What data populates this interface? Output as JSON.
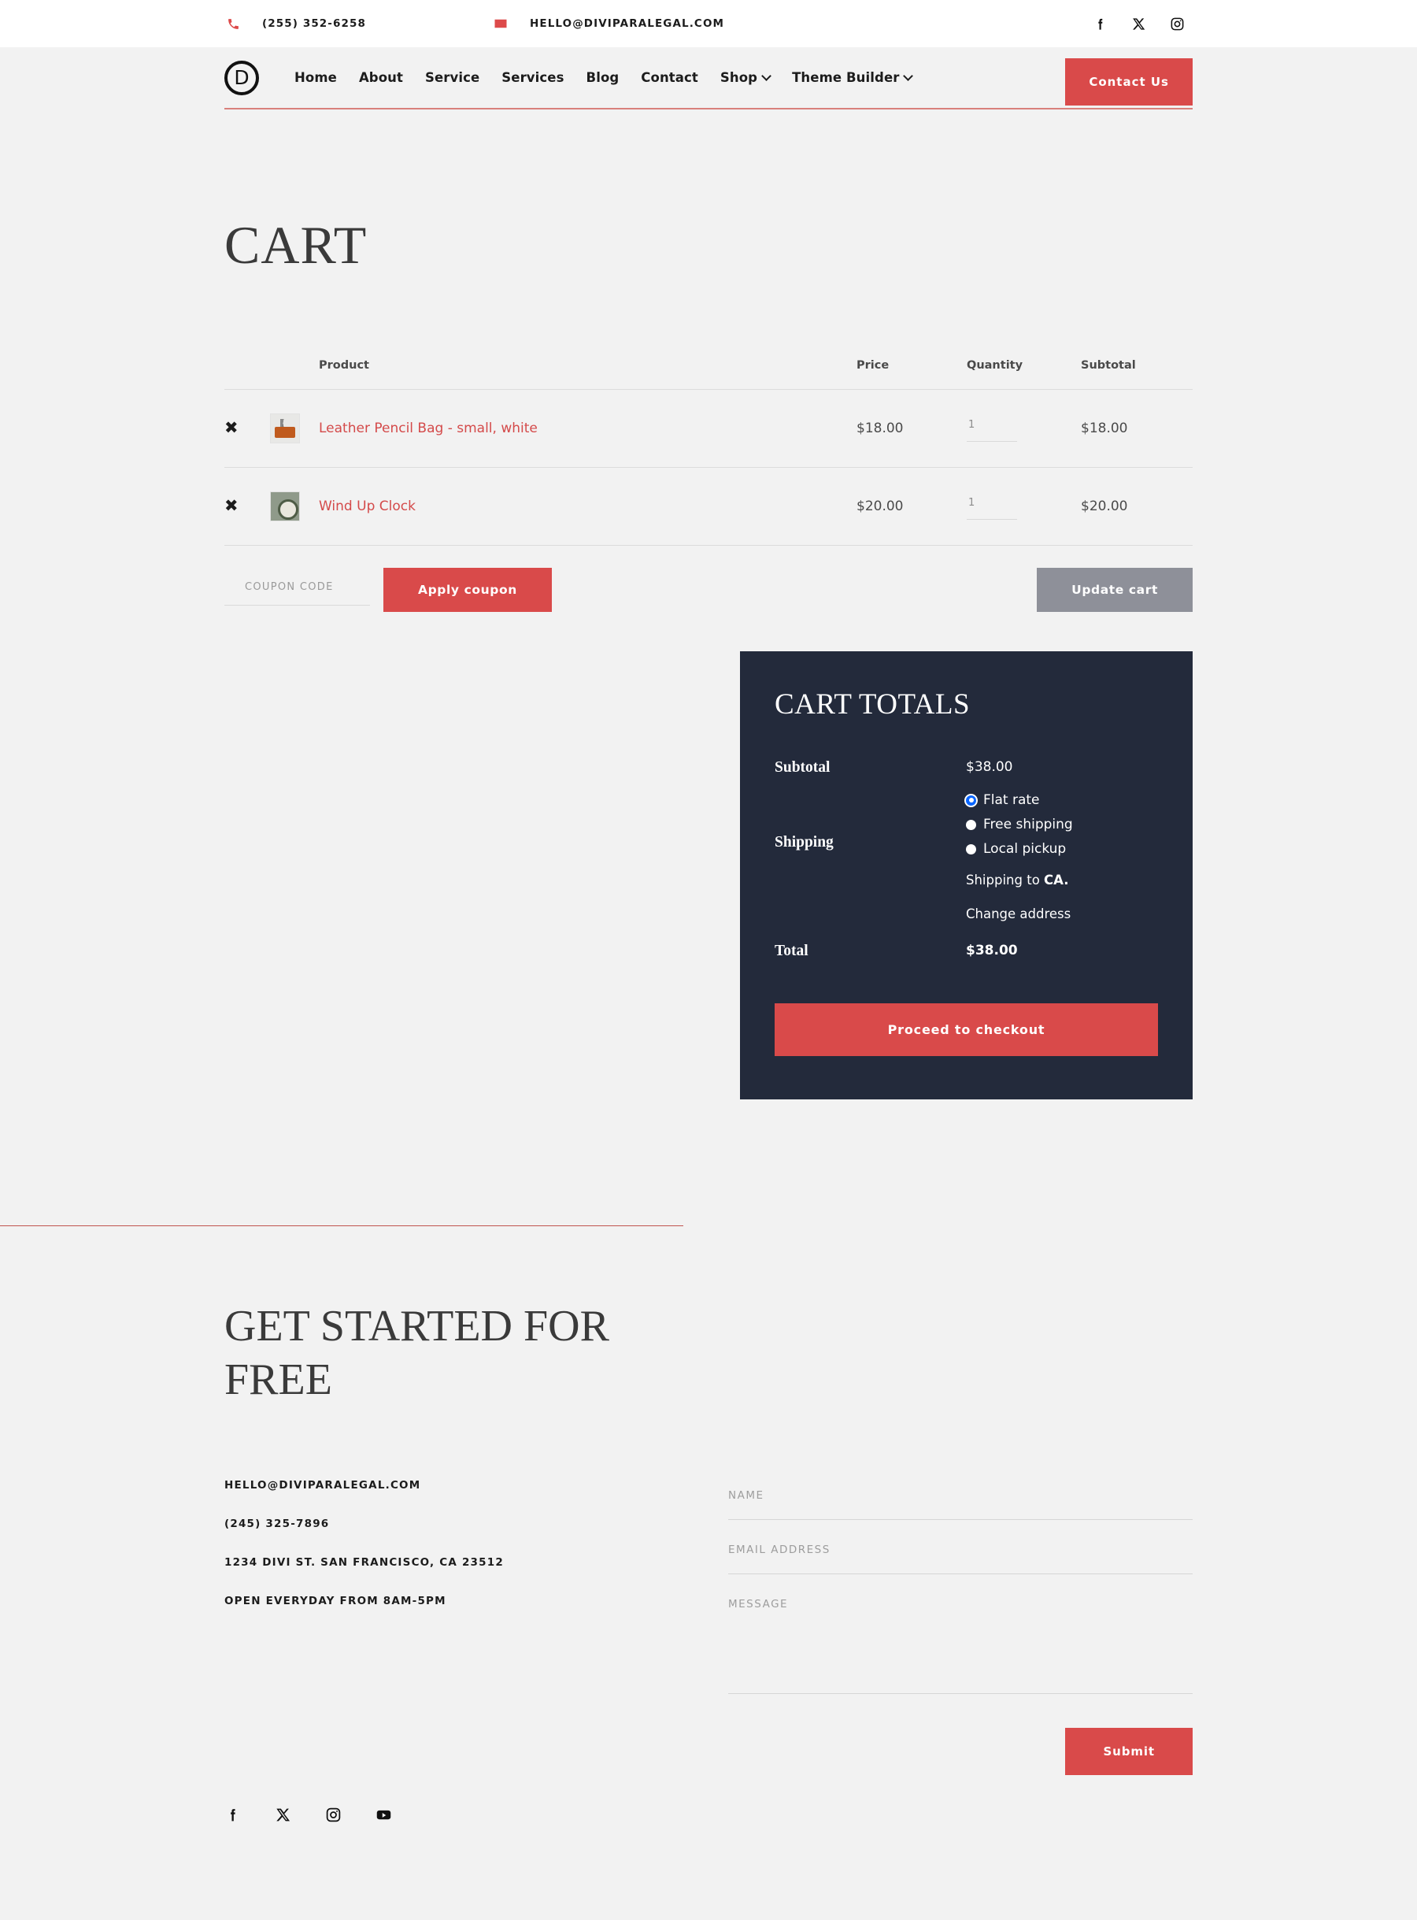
{
  "topbar": {
    "phone": "(255) 352-6258",
    "email": "HELLO@DIVIPARALEGAL.COM",
    "socials": [
      "facebook-icon",
      "x-twitter-icon",
      "instagram-icon"
    ]
  },
  "nav": {
    "logo_letter": "D",
    "items": [
      {
        "label": "Home",
        "has_dropdown": false
      },
      {
        "label": "About",
        "has_dropdown": false
      },
      {
        "label": "Service",
        "has_dropdown": false
      },
      {
        "label": "Services",
        "has_dropdown": false
      },
      {
        "label": "Blog",
        "has_dropdown": false
      },
      {
        "label": "Contact",
        "has_dropdown": false
      },
      {
        "label": "Shop",
        "has_dropdown": true
      },
      {
        "label": "Theme Builder",
        "has_dropdown": true
      }
    ],
    "cta_label": "Contact Us"
  },
  "page": {
    "title": "CART"
  },
  "cart": {
    "headers": {
      "product": "Product",
      "price": "Price",
      "quantity": "Quantity",
      "subtotal": "Subtotal"
    },
    "remove_glyph": "✖",
    "items": [
      {
        "name": "Leather Pencil Bag - small, white",
        "price": "$18.00",
        "quantity": "1",
        "subtotal": "$18.00",
        "thumb": "leather-pencil-bag-thumbnail"
      },
      {
        "name": "Wind Up Clock",
        "price": "$20.00",
        "quantity": "1",
        "subtotal": "$20.00",
        "thumb": "wind-up-clock-thumbnail"
      }
    ],
    "coupon_placeholder": "COUPON CODE",
    "coupon_value": "",
    "apply_coupon_label": "Apply coupon",
    "update_cart_label": "Update cart"
  },
  "totals": {
    "heading": "CART TOTALS",
    "subtotal_label": "Subtotal",
    "subtotal_value": "$38.00",
    "shipping_label": "Shipping",
    "shipping_options": [
      {
        "label": "Flat rate",
        "selected": true
      },
      {
        "label": "Free shipping",
        "selected": false
      },
      {
        "label": "Local pickup",
        "selected": false
      }
    ],
    "shipping_to_prefix": "Shipping to ",
    "shipping_to_region": "CA.",
    "change_address_label": "Change address",
    "total_label": "Total",
    "total_value": "$38.00",
    "checkout_label": "Proceed to checkout",
    "panel_color": "#232a3b",
    "accent_color": "#d94a4a"
  },
  "cta": {
    "heading": "GET STARTED FOR FREE",
    "info": [
      "HELLO@DIVIPARALEGAL.COM",
      "(245) 325-7896",
      "1234 DIVI ST. SAN FRANCISCO, CA 23512",
      "OPEN EVERYDAY FROM 8AM-5PM"
    ],
    "form": {
      "name_placeholder": "NAME",
      "name_value": "",
      "email_placeholder": "EMAIL ADDRESS",
      "email_value": "",
      "message_placeholder": "MESSAGE",
      "message_value": "",
      "submit_label": "Submit"
    },
    "socials": [
      "facebook-icon",
      "x-twitter-icon",
      "instagram-icon",
      "youtube-icon"
    ]
  }
}
